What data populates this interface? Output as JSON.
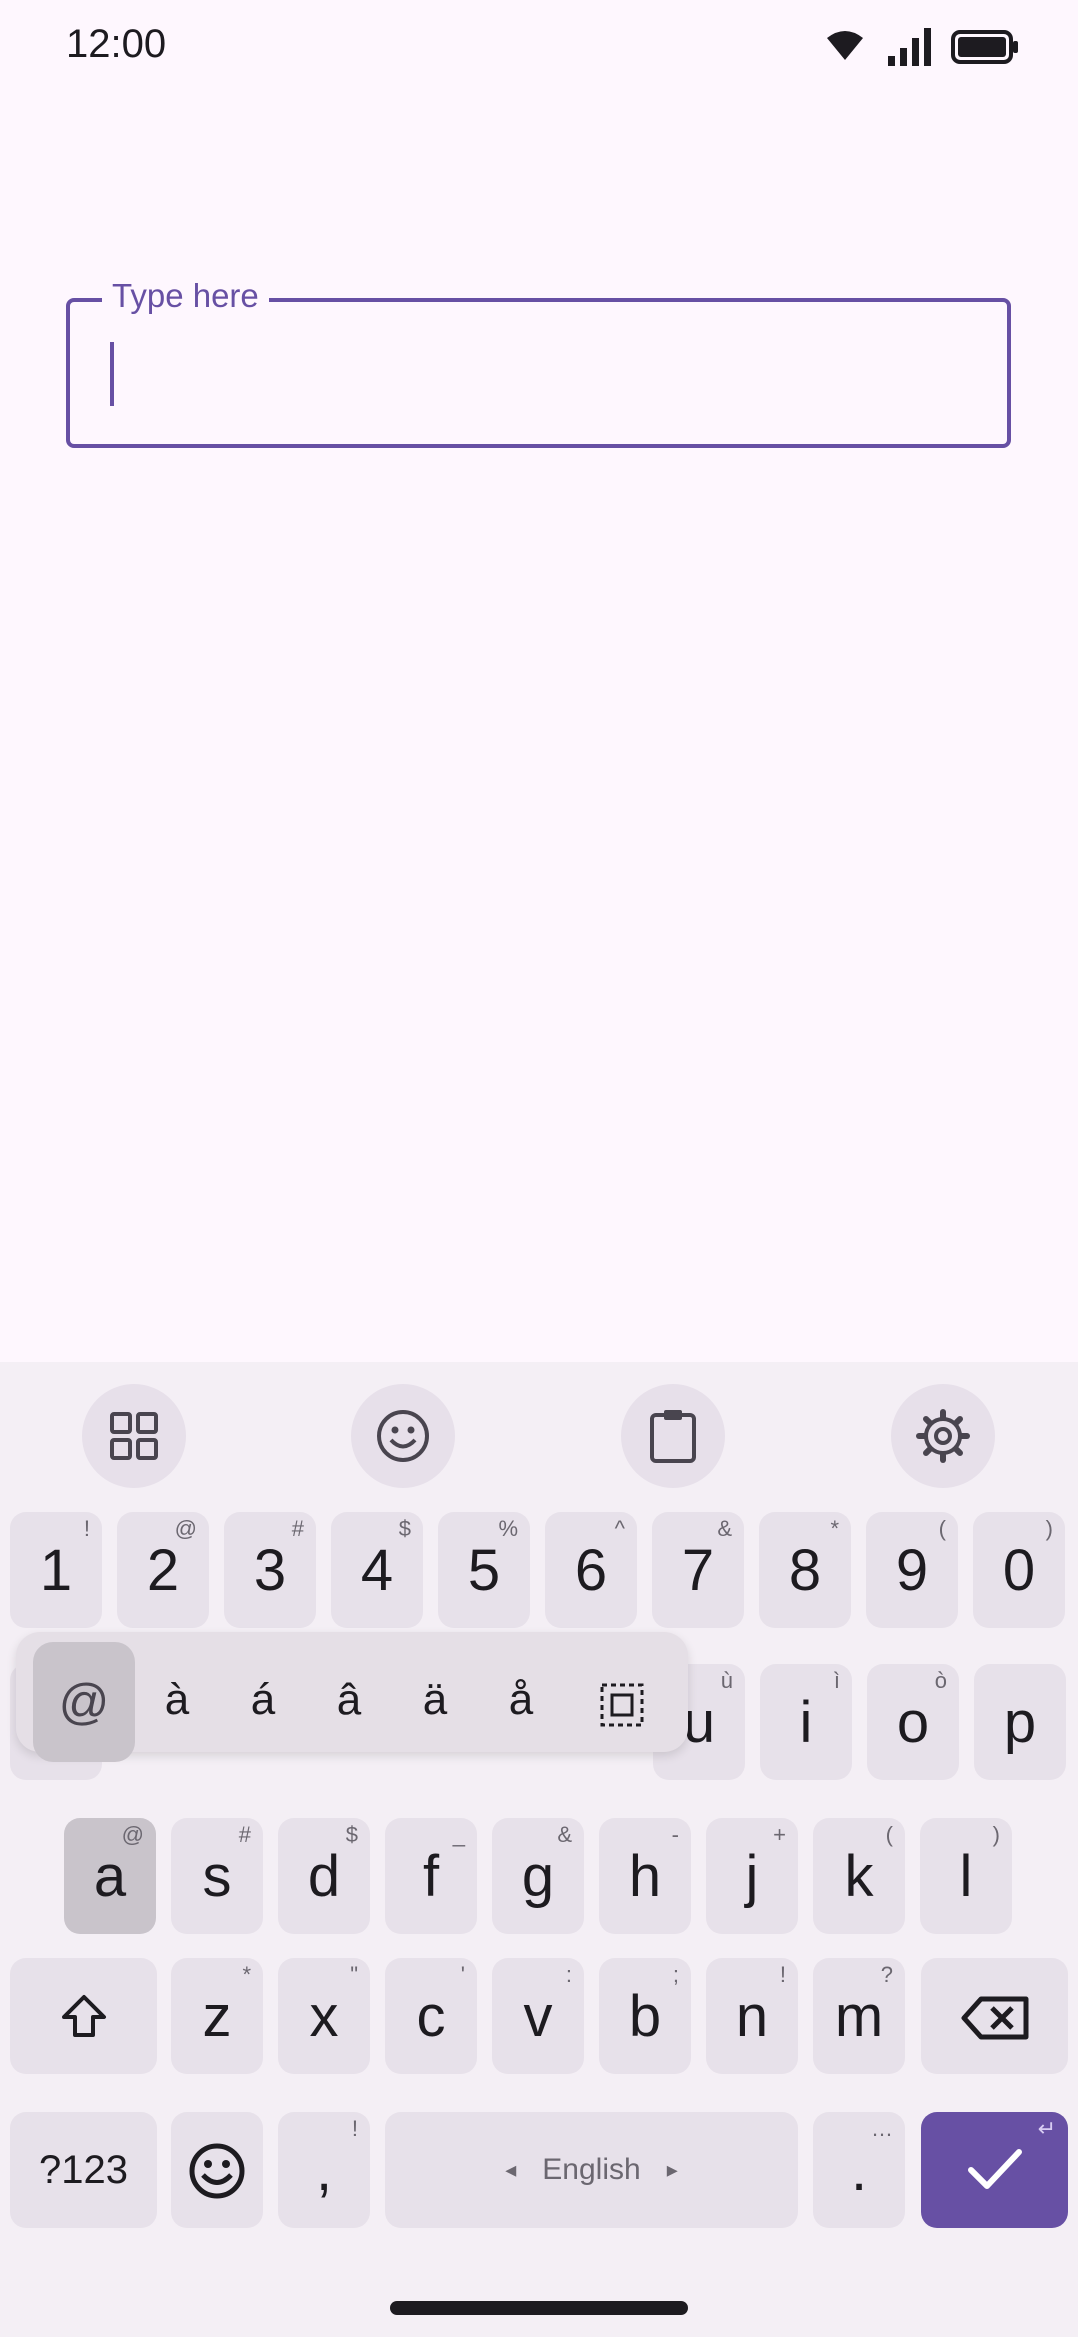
{
  "status_bar": {
    "time": "12:00"
  },
  "text_field": {
    "label": "Type here",
    "value": ""
  },
  "toolbar": {
    "icons": [
      "apps-grid-icon",
      "emoji-icon",
      "clipboard-icon",
      "settings-icon"
    ]
  },
  "keyboard": {
    "number_row": [
      {
        "main": "1",
        "hint": "!"
      },
      {
        "main": "2",
        "hint": "@"
      },
      {
        "main": "3",
        "hint": "#"
      },
      {
        "main": "4",
        "hint": "$"
      },
      {
        "main": "5",
        "hint": "%"
      },
      {
        "main": "6",
        "hint": "^"
      },
      {
        "main": "7",
        "hint": "&"
      },
      {
        "main": "8",
        "hint": "*"
      },
      {
        "main": "9",
        "hint": "("
      },
      {
        "main": "0",
        "hint": ")"
      }
    ],
    "row_top_visible": [
      {
        "main": "u",
        "hint": "ù"
      },
      {
        "main": "i",
        "hint": "ì"
      },
      {
        "main": "o",
        "hint": "ò"
      },
      {
        "main": "p",
        "hint": ""
      }
    ],
    "row_home": [
      {
        "main": "a",
        "hint": "@"
      },
      {
        "main": "s",
        "hint": "#"
      },
      {
        "main": "d",
        "hint": "$"
      },
      {
        "main": "f",
        "hint": "_"
      },
      {
        "main": "g",
        "hint": "&"
      },
      {
        "main": "h",
        "hint": "-"
      },
      {
        "main": "j",
        "hint": "+"
      },
      {
        "main": "k",
        "hint": "("
      },
      {
        "main": "l",
        "hint": ")"
      }
    ],
    "row_bottom": [
      {
        "main": "z",
        "hint": "*"
      },
      {
        "main": "x",
        "hint": "\""
      },
      {
        "main": "c",
        "hint": "'"
      },
      {
        "main": "v",
        "hint": ":"
      },
      {
        "main": "b",
        "hint": ";"
      },
      {
        "main": "n",
        "hint": "!"
      },
      {
        "main": "m",
        "hint": "?"
      }
    ],
    "accent_popup": [
      "@",
      "à",
      "á",
      "â",
      "ä",
      "å"
    ],
    "symbols_key": "?123",
    "comma_key": {
      "main": ",",
      "hint": "!"
    },
    "space_label": "English",
    "space_left_arrow": "◂",
    "space_right_arrow": "▸",
    "period_key": {
      "main": ".",
      "hint": "…"
    },
    "enter_hint": "↵",
    "accent_color": "#6750a4"
  }
}
